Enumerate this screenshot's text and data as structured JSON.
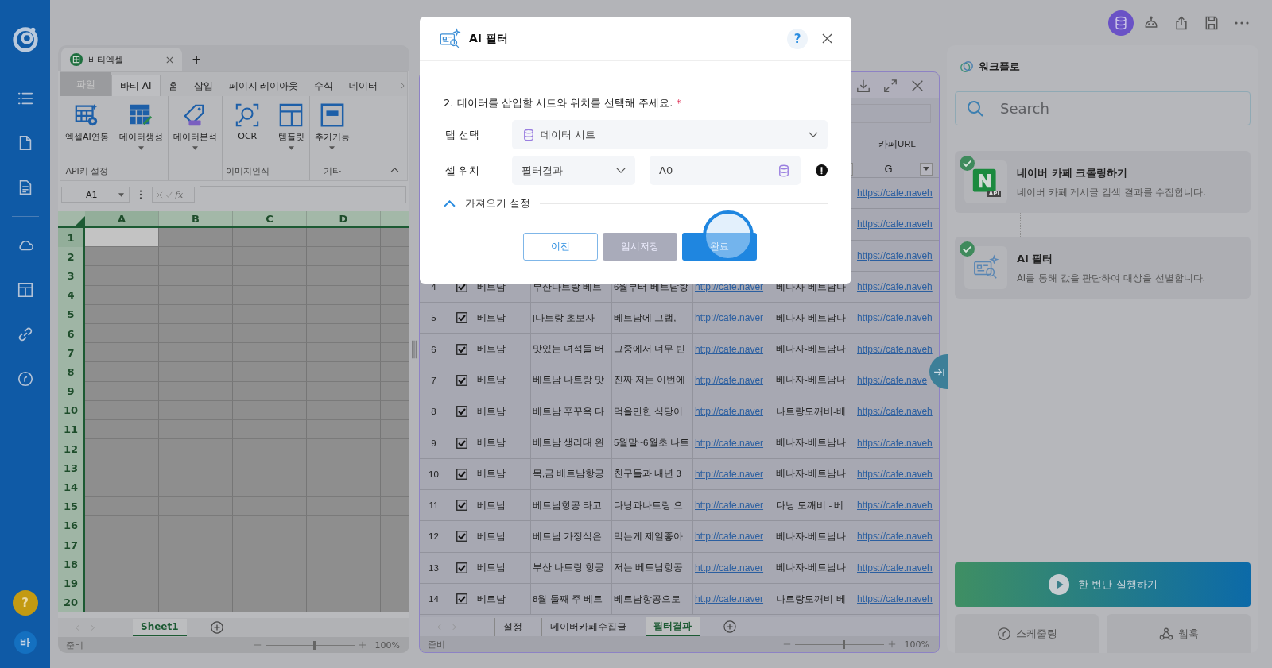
{
  "sidebar": {
    "help": "?",
    "avatar": "바"
  },
  "toolbar": [
    {
      "kind": "database",
      "selected": true
    },
    {
      "kind": "robot",
      "selected": false
    },
    {
      "kind": "share",
      "selected": false
    },
    {
      "kind": "save",
      "selected": false
    },
    {
      "kind": "more",
      "selected": false
    }
  ],
  "workbook": {
    "title": "바티엑셀",
    "add_tab": "+",
    "ribbon_tabs": [
      {
        "label": "파일",
        "kind": "file",
        "selected": false
      },
      {
        "label": "바티 AI",
        "kind": "tab",
        "selected": true
      },
      {
        "label": "홈",
        "kind": "tab",
        "selected": false
      },
      {
        "label": "삽입",
        "kind": "tab",
        "selected": false
      },
      {
        "label": "페이지 레이아웃",
        "kind": "tab",
        "selected": false
      },
      {
        "label": "수식",
        "kind": "tab",
        "selected": false
      },
      {
        "label": "데이터",
        "kind": "tab",
        "selected": false
      }
    ],
    "ribbon_groups": [
      {
        "label": "API키 설정",
        "button": {
          "label": "엑셀AI연동",
          "kind": "excel-ai",
          "dropdown": false
        }
      },
      {
        "button": {
          "label": "데이터생성",
          "kind": "generate",
          "dropdown": true
        }
      },
      {
        "button": {
          "label": "데이터분석",
          "kind": "analyze",
          "dropdown": true
        }
      },
      {
        "label": "이미지인식",
        "button": {
          "label": "OCR",
          "kind": "ocr",
          "dropdown": false
        }
      },
      {
        "button": {
          "label": "템플릿",
          "kind": "template",
          "dropdown": true
        }
      },
      {
        "label": "기타",
        "button": {
          "label": "추가기능",
          "kind": "etc",
          "dropdown": true
        }
      }
    ],
    "name_box": "A1",
    "fx": "fx",
    "columns": [
      {
        "letter": "A",
        "selected": true
      },
      {
        "letter": "B",
        "selected": false
      },
      {
        "letter": "C",
        "selected": false
      },
      {
        "letter": "D",
        "selected": false
      }
    ],
    "rows": [
      {
        "number": "1",
        "selected": true
      },
      {
        "number": "2",
        "selected": false
      },
      {
        "number": "3",
        "selected": false
      },
      {
        "number": "4",
        "selected": false
      },
      {
        "number": "5",
        "selected": false
      },
      {
        "number": "6",
        "selected": false
      },
      {
        "number": "7",
        "selected": false
      },
      {
        "number": "8",
        "selected": false
      },
      {
        "number": "9",
        "selected": false
      },
      {
        "number": "10",
        "selected": false
      },
      {
        "number": "11",
        "selected": false
      },
      {
        "number": "12",
        "selected": false
      },
      {
        "number": "13",
        "selected": false
      },
      {
        "number": "14",
        "selected": false
      },
      {
        "number": "15",
        "selected": false
      },
      {
        "number": "16",
        "selected": false
      },
      {
        "number": "17",
        "selected": false
      },
      {
        "number": "18",
        "selected": false
      },
      {
        "number": "19",
        "selected": false
      },
      {
        "number": "20",
        "selected": false
      }
    ],
    "sheet_tabs": [
      {
        "label": "Sheet1",
        "selected": true
      }
    ],
    "status": "준비",
    "zoom_slider": {
      "level": 0.55
    },
    "zoom": "100%"
  },
  "result_sheet": {
    "header_label": "카페URL",
    "column_letter": "G",
    "rows": [
      {
        "cafe_url": "https://cafe.naveh"
      },
      {
        "cafe_url": "https://cafe.naveh"
      },
      {
        "cafe_url": "https://cafe.naveh"
      },
      {
        "number": "4",
        "checked": true,
        "country": "베트남",
        "title": "부산나트랑 베트",
        "content": "6월부터 베트남항",
        "url": "http://cafe.naver",
        "cafe": "베나자-베트남나",
        "cafe_url": "https://cafe.naveh"
      },
      {
        "number": "5",
        "checked": true,
        "country": "베트남",
        "title": "[나트랑 초보자",
        "content": "베트남에 그랩,",
        "url": "http://cafe.naver",
        "cafe": "베나자-베트남나",
        "cafe_url": "https://cafe.naveh"
      },
      {
        "number": "6",
        "checked": true,
        "country": "베트남",
        "title": "맛있는 녀석들 버",
        "content": "그중에서 너무 빈",
        "url": "http://cafe.naver",
        "cafe": "베나자-베트남나",
        "cafe_url": "https://cafe.naveh"
      },
      {
        "number": "7",
        "checked": true,
        "country": "베트남",
        "title": "베트남 나트랑 맛",
        "content": "진짜 저는 이번에",
        "url": "http://cafe.naver",
        "cafe": "베나자-베트남나",
        "cafe_url": "https://cafe.nave"
      },
      {
        "number": "8",
        "checked": true,
        "country": "베트남",
        "title": "베트남 푸꾸옥 다",
        "content": "먹을만한 식당이",
        "url": "http://cafe.naver",
        "cafe": "나트랑도깨비-베",
        "cafe_url": "https://cafe.naveh"
      },
      {
        "number": "9",
        "checked": true,
        "country": "베트남",
        "title": "베트남 생리대 왼",
        "content": "5월말~6월초 나트",
        "url": "http://cafe.naver",
        "cafe": "베나자-베트남나",
        "cafe_url": "https://cafe.naveh"
      },
      {
        "number": "10",
        "checked": true,
        "country": "베트남",
        "title": "목,금 베트남항공",
        "content": "친구들과 내년 3",
        "url": "http://cafe.naver",
        "cafe": "베나자-베트남나",
        "cafe_url": "https://cafe.naveh"
      },
      {
        "number": "11",
        "checked": true,
        "country": "베트남",
        "title": "베트남항공 타고",
        "content": "다낭과나트랑 으",
        "url": "http://cafe.naver",
        "cafe": "다낭 도깨비 - 베",
        "cafe_url": "https://cafe.naveh"
      },
      {
        "number": "12",
        "checked": true,
        "country": "베트남",
        "title": "베트남 가정식은",
        "content": "먹는게 제일좋아",
        "url": "http://cafe.naver",
        "cafe": "베나자-베트남나",
        "cafe_url": "https://cafe.naveh"
      },
      {
        "number": "13",
        "checked": true,
        "country": "베트남",
        "title": "부산 나트랑 항공",
        "content": "저는 베트남항공",
        "url": "http://cafe.naver",
        "cafe": "베나자-베트남나",
        "cafe_url": "https://cafe.naveh"
      },
      {
        "number": "14",
        "checked": true,
        "country": "베트남",
        "title": "8월 둘째 주 베트",
        "content": "베트남항공으로",
        "url": "http://cafe.naver",
        "cafe": "나트랑도깨비-베",
        "cafe_url": "https://cafe.naveh"
      }
    ],
    "sheet_tabs": [
      {
        "label": "설정",
        "selected": false
      },
      {
        "label": "네이버카페수집글",
        "selected": false
      },
      {
        "label": "필터결과",
        "selected": true
      }
    ],
    "status": "준비",
    "zoom_slider": {
      "level": 0.55
    },
    "zoom": "100%"
  },
  "dialog": {
    "title": "AI 필터",
    "help": "?",
    "question": "2. 데이터를 삽입할 시트와 위치를 선택해 주세요.",
    "required_mark": "*",
    "tab_label": "탭 선택",
    "tab_value": "데이터 시트",
    "cell_label": "셀 위치",
    "sheet_value": "필터결과",
    "cell_value": "A0",
    "import_settings": {
      "label": "가져오기 설정",
      "expanded": true
    },
    "buttons": [
      {
        "label": "이전",
        "kind": "outline"
      },
      {
        "label": "임시저장",
        "kind": "secondary"
      },
      {
        "label": "완료",
        "kind": "primary",
        "pressed": true
      }
    ]
  },
  "workflow": {
    "title": "워크플로",
    "search": {
      "placeholder": "Search"
    },
    "steps": [
      {
        "kind": "naver",
        "done": true,
        "title": "네이버 카페 크롤링하기",
        "description": "네이버 카페 게시글 검색 결과를 수집합니다.",
        "badge": "API"
      },
      {
        "kind": "ai-filter",
        "done": true,
        "title": "AI 필터",
        "description": "AI를 통해 값을 판단하여 대상을 선별합니다."
      }
    ],
    "run_button": "한 번만 실행하기",
    "buttons": [
      {
        "label": "스케줄링",
        "kind": "schedule"
      },
      {
        "label": "웹훅",
        "kind": "webhook"
      }
    ]
  }
}
